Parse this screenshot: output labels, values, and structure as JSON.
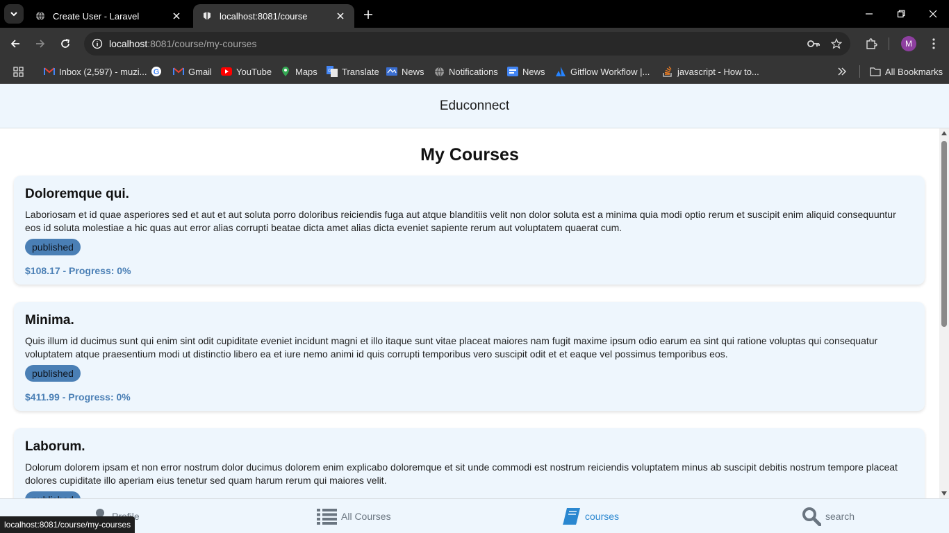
{
  "browser": {
    "tabs": [
      {
        "title": "Create User - Laravel",
        "active": false
      },
      {
        "title": "localhost:8081/course",
        "active": true
      }
    ],
    "omnibox": {
      "host": "localhost",
      "path": ":8081/course/my-courses"
    },
    "avatar_letter": "M",
    "bookmarks": [
      {
        "label": "Inbox (2,597) - muzi...",
        "icon": "gmail-icon"
      },
      {
        "label": "",
        "icon": "google-icon"
      },
      {
        "label": "Gmail",
        "icon": "gmail-icon"
      },
      {
        "label": "YouTube",
        "icon": "youtube-icon"
      },
      {
        "label": "Maps",
        "icon": "maps-icon"
      },
      {
        "label": "Translate",
        "icon": "translate-icon"
      },
      {
        "label": "News",
        "icon": "news-icon"
      },
      {
        "label": "Notifications",
        "icon": "globe-icon"
      },
      {
        "label": "News",
        "icon": "google-news-icon"
      },
      {
        "label": "Gitflow Workflow |...",
        "icon": "atlassian-icon"
      },
      {
        "label": "javascript - How to...",
        "icon": "stackoverflow-icon"
      }
    ],
    "all_bookmarks": "All Bookmarks",
    "status_url": "localhost:8081/course/my-courses"
  },
  "app": {
    "title": "Educonnect"
  },
  "page": {
    "heading": "My Courses",
    "courses": [
      {
        "title": "Doloremque qui.",
        "description": "Laboriosam et id quae asperiores sed et aut et aut soluta porro doloribus reiciendis fuga aut atque blanditiis velit non dolor soluta est a minima quia modi optio rerum et suscipit enim aliquid consequuntur eos id soluta molestiae a hic quas aut error alias corrupti beatae dicta amet alias dicta eveniet sapiente rerum aut voluptatem quaerat cum.",
        "status": "published",
        "meta": "$108.17 - Progress: 0%"
      },
      {
        "title": "Minima.",
        "description": "Quis illum id ducimus sunt qui enim sint odit cupiditate eveniet incidunt magni et illo itaque sunt vitae placeat maiores nam fugit maxime ipsum odio earum ea sint qui ratione voluptas qui consequatur voluptatem atque praesentium modi ut distinctio libero ea et iure nemo animi id quis corrupti temporibus vero suscipit odit et et eaque vel possimus temporibus eos.",
        "status": "published",
        "meta": "$411.99 - Progress: 0%"
      },
      {
        "title": "Laborum.",
        "description": "Dolorum dolorem ipsam et non error nostrum dolor ducimus dolorem enim explicabo doloremque et sit unde commodi est nostrum reiciendis voluptatem minus ab suscipit debitis nostrum tempore placeat dolores cupiditate illo aperiam eius tenetur sed quam harum rerum qui maiores velit.",
        "status": "published",
        "meta": ""
      }
    ]
  },
  "bottom_nav": [
    {
      "label": "Profile",
      "icon": "user-icon",
      "active": false
    },
    {
      "label": "All Courses",
      "icon": "list-icon",
      "active": false
    },
    {
      "label": "courses",
      "icon": "book-icon",
      "active": true
    },
    {
      "label": "search",
      "icon": "search-icon",
      "active": false
    }
  ],
  "colors": {
    "accent": "#2a87d0",
    "card_bg": "#eef6fd",
    "badge": "#4a7fb5"
  }
}
